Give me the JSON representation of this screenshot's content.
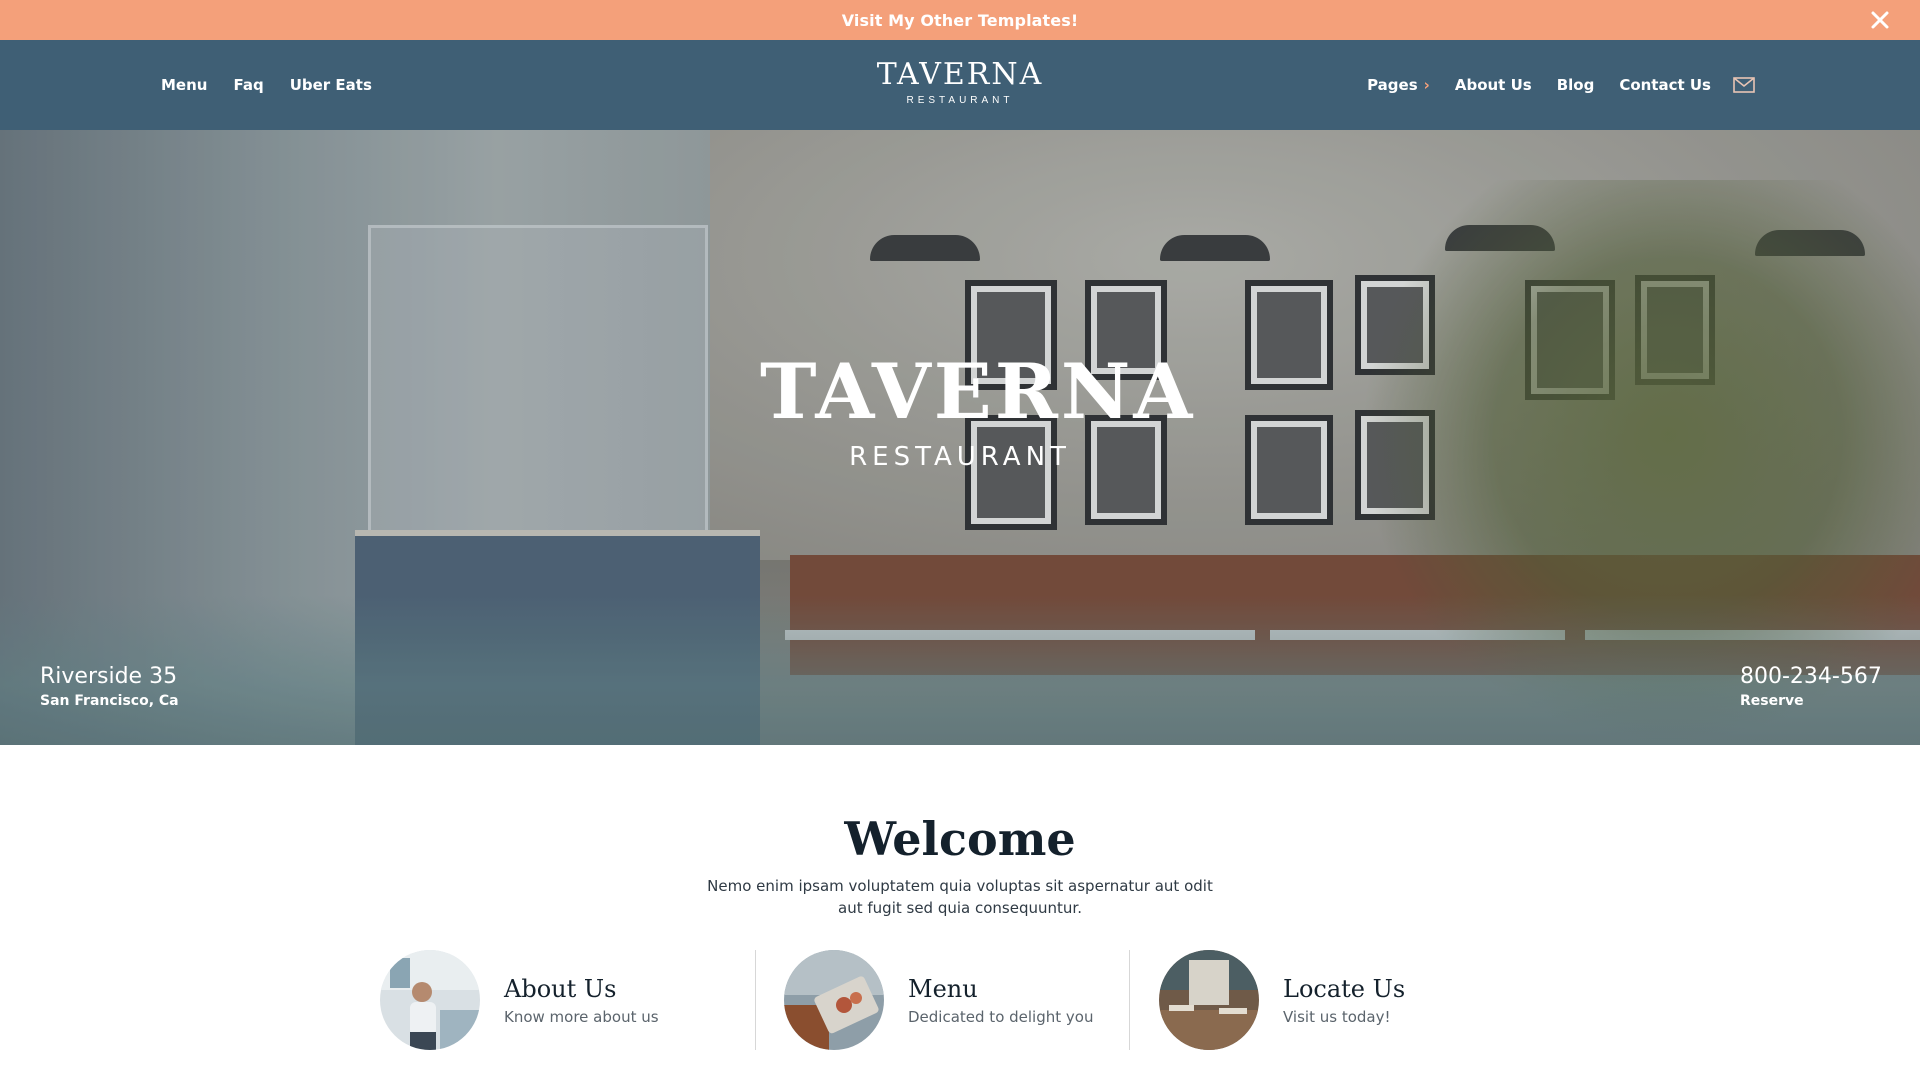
{
  "topbar": {
    "link_label": "Visit My Other Templates!",
    "close_icon": "close-icon",
    "bg_color": "#f4a07a"
  },
  "nav": {
    "left_items": [
      {
        "label": "Menu"
      },
      {
        "label": "Faq"
      },
      {
        "label": "Uber Eats"
      }
    ],
    "logo_main": "TAVERNA",
    "logo_sub": "RESTAURANT",
    "right_items": [
      {
        "label": "Pages",
        "icon": "chevron-right-icon"
      },
      {
        "label": "About Us"
      },
      {
        "label": "Blog"
      },
      {
        "label": "Contact Us"
      }
    ],
    "mail_icon": "mail-icon",
    "bg_color": "#3f5f75"
  },
  "hero": {
    "logo_main": "TAVERNA",
    "logo_sub": "RESTAURANT",
    "address_line1": "Riverside 35",
    "address_line2": "San Francisco, Ca",
    "phone": "800-234-567",
    "phone_action": "Reserve"
  },
  "welcome": {
    "title": "Welcome",
    "text": "Nemo enim ipsam voluptatem quia voluptas sit aspernatur aut odit aut fugit sed quia consequuntur."
  },
  "features": [
    {
      "title": "About Us",
      "subtitle": "Know more about us"
    },
    {
      "title": "Menu",
      "subtitle": "Dedicated to delight you"
    },
    {
      "title": "Locate Us",
      "subtitle": "Visit us today!"
    }
  ]
}
